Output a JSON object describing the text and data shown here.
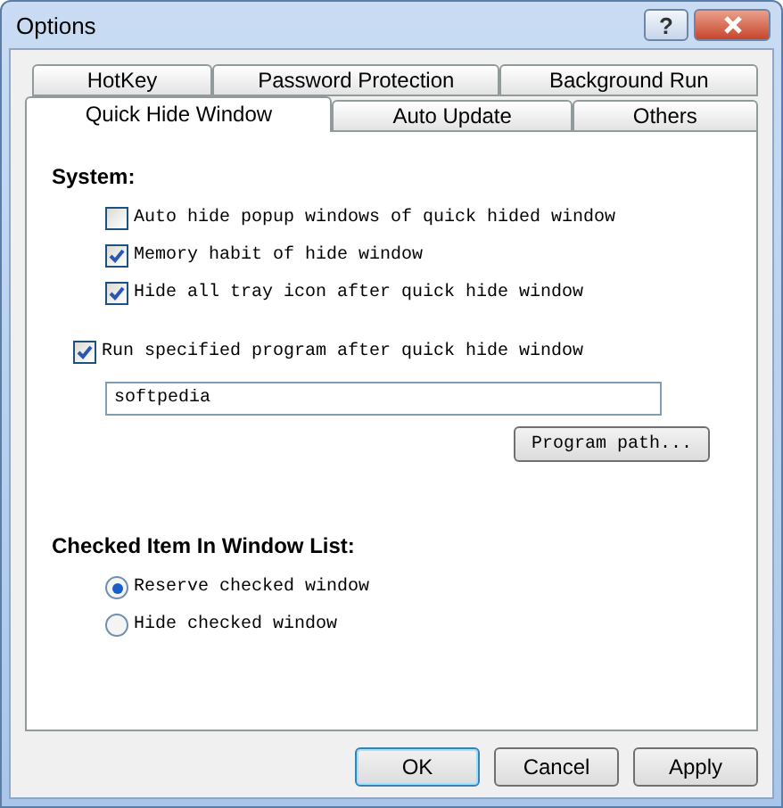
{
  "window": {
    "title": "Options",
    "help_button": "?"
  },
  "tab_rows": [
    [
      {
        "label": "HotKey",
        "selected": false
      },
      {
        "label": "Password Protection",
        "selected": false
      },
      {
        "label": "Background Run",
        "selected": false
      }
    ],
    [
      {
        "label": "Quick Hide Window",
        "selected": true
      },
      {
        "label": "Auto Update",
        "selected": false
      },
      {
        "label": "Others",
        "selected": false
      }
    ]
  ],
  "system": {
    "heading": "System:",
    "options": [
      {
        "label": "Auto hide popup windows of quick hided window",
        "checked": false
      },
      {
        "label": "Memory habit of hide window",
        "checked": true
      },
      {
        "label": "Hide all tray icon after quick hide window",
        "checked": true
      }
    ]
  },
  "run_program": {
    "label": "Run specified program after quick hide window",
    "checked": true,
    "value": "softpedia",
    "browse_button": "Program path..."
  },
  "window_list": {
    "heading": "Checked Item In Window List:",
    "options": [
      {
        "label": "Reserve checked window",
        "selected": true
      },
      {
        "label": "Hide checked window",
        "selected": false
      }
    ]
  },
  "buttons": [
    {
      "label": "OK",
      "default": true
    },
    {
      "label": "Cancel",
      "default": false
    },
    {
      "label": "Apply",
      "default": false
    }
  ]
}
